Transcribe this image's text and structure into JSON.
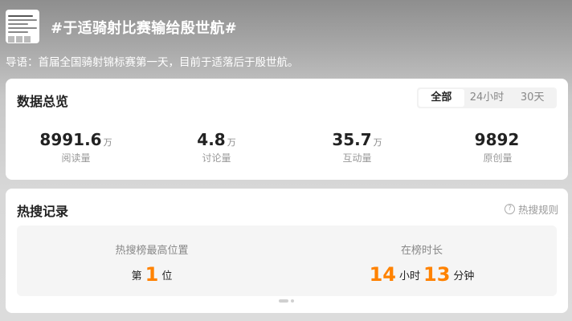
{
  "topic": {
    "title": "#于适骑射比赛输给殷世航#",
    "intro": "导语：首届全国骑射锦标赛第一天，目前于适落后于殷世航。"
  },
  "overview": {
    "title": "数据总览",
    "tabs": [
      "全部",
      "24小时",
      "30天"
    ],
    "active_tab": "全部",
    "stats": [
      {
        "value": "8991.6",
        "unit": "万",
        "label": "阅读量"
      },
      {
        "value": "4.8",
        "unit": "万",
        "label": "讨论量"
      },
      {
        "value": "35.7",
        "unit": "万",
        "label": "互动量"
      },
      {
        "value": "9892",
        "unit": "",
        "label": "原创量"
      }
    ]
  },
  "hotsearch": {
    "title": "热搜记录",
    "rules_label": "热搜规则",
    "rules_icon": "question-circle-icon",
    "highest_label": "热搜榜最高位置",
    "pos_prefix": "第",
    "pos_value": "1",
    "pos_suffix": "位",
    "duration_label": "在榜时长",
    "hours": "14",
    "hours_unit": "小时",
    "minutes": "13",
    "minutes_unit": "分钟"
  },
  "colors": {
    "accent": "#ff8200",
    "card": "#ffffff",
    "inner": "#f5f5f5"
  }
}
